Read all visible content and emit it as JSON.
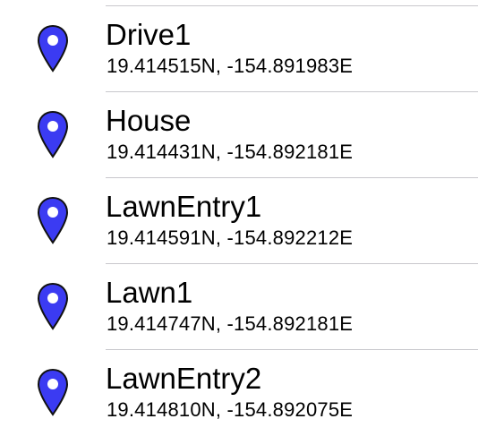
{
  "accent_color": "#3b3bf2",
  "locations": [
    {
      "name": "Drive1",
      "coords": "19.414515N, -154.891983E",
      "icon": "map-pin-icon"
    },
    {
      "name": "House",
      "coords": "19.414431N, -154.892181E",
      "icon": "map-pin-icon"
    },
    {
      "name": "LawnEntry1",
      "coords": "19.414591N, -154.892212E",
      "icon": "map-pin-icon"
    },
    {
      "name": "Lawn1",
      "coords": "19.414747N, -154.892181E",
      "icon": "map-pin-icon"
    },
    {
      "name": "LawnEntry2",
      "coords": "19.414810N, -154.892075E",
      "icon": "map-pin-icon"
    }
  ]
}
